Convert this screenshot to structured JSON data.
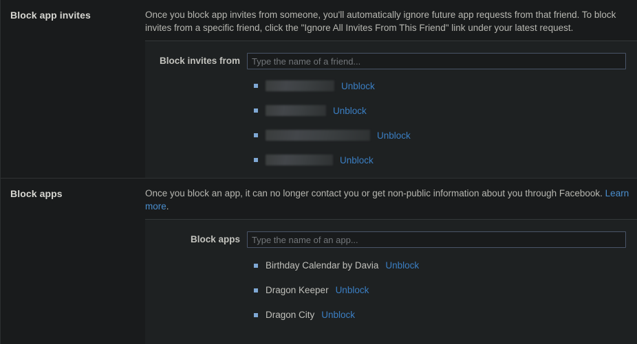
{
  "sections": [
    {
      "id": "block-app-invites",
      "title": "Block app invites",
      "description": "Once you block app invites from someone, you'll automatically ignore future app requests from that friend. To block invites from a specific friend, click the \"Ignore All Invites From This Friend\" link under your latest request.",
      "form": {
        "label": "Block invites from",
        "input_value": "",
        "placeholder": "Type the name of a friend..."
      },
      "items": [
        {
          "name": "",
          "redacted": true,
          "redacted_width": 100,
          "action_label": "Unblock"
        },
        {
          "name": "",
          "redacted": true,
          "redacted_width": 88,
          "action_label": "Unblock"
        },
        {
          "name": "",
          "redacted": true,
          "redacted_width": 152,
          "action_label": "Unblock"
        },
        {
          "name": "",
          "redacted": true,
          "redacted_width": 98,
          "action_label": "Unblock"
        }
      ]
    },
    {
      "id": "block-apps",
      "title": "Block apps",
      "description_before_link": "Once you block an app, it can no longer contact you or get non-public information about you through Facebook. ",
      "description_link": "Learn more",
      "description_after_link": ".",
      "form": {
        "label": "Block apps",
        "input_value": "",
        "placeholder": "Type the name of an app..."
      },
      "items": [
        {
          "name": "Birthday Calendar by Davia",
          "redacted": false,
          "action_label": "Unblock"
        },
        {
          "name": "Dragon Keeper",
          "redacted": false,
          "action_label": "Unblock"
        },
        {
          "name": "Dragon City",
          "redacted": false,
          "action_label": "Unblock"
        }
      ]
    }
  ],
  "colors": {
    "background": "#191b1c",
    "panel": "#1e2122",
    "link": "#3b7fc4",
    "bullet": "#7fa8d4",
    "text": "#c0c0bb",
    "heading": "#d7d7d2",
    "input_border": "#4a5569"
  }
}
